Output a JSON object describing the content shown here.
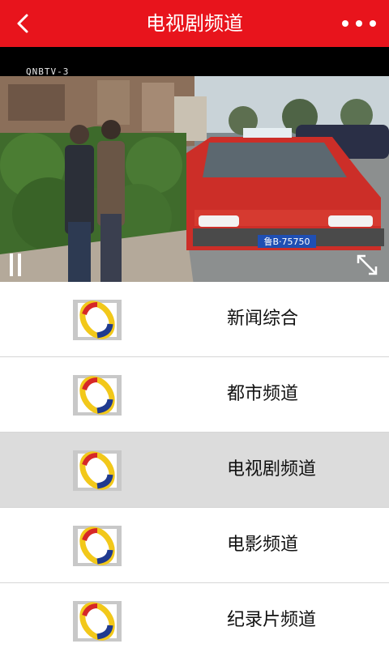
{
  "header": {
    "title": "电视剧频道",
    "back_icon": "chevron-left-icon",
    "more_icon": "more-horizontal-icon",
    "bar_color": "#e8141c"
  },
  "player": {
    "watermark": "QNBTV-3",
    "plate_text": "鲁B·75750",
    "pause_icon": "pause-icon",
    "fullscreen_icon": "fullscreen-icon"
  },
  "channels": [
    {
      "name": "新闻综合",
      "icon": "channel-logo-icon",
      "selected": false
    },
    {
      "name": "都市频道",
      "icon": "channel-logo-icon",
      "selected": false
    },
    {
      "name": "电视剧频道",
      "icon": "channel-logo-icon",
      "selected": true
    },
    {
      "name": "电影频道",
      "icon": "channel-logo-icon",
      "selected": false
    },
    {
      "name": "纪录片频道",
      "icon": "channel-logo-icon",
      "selected": false
    }
  ]
}
